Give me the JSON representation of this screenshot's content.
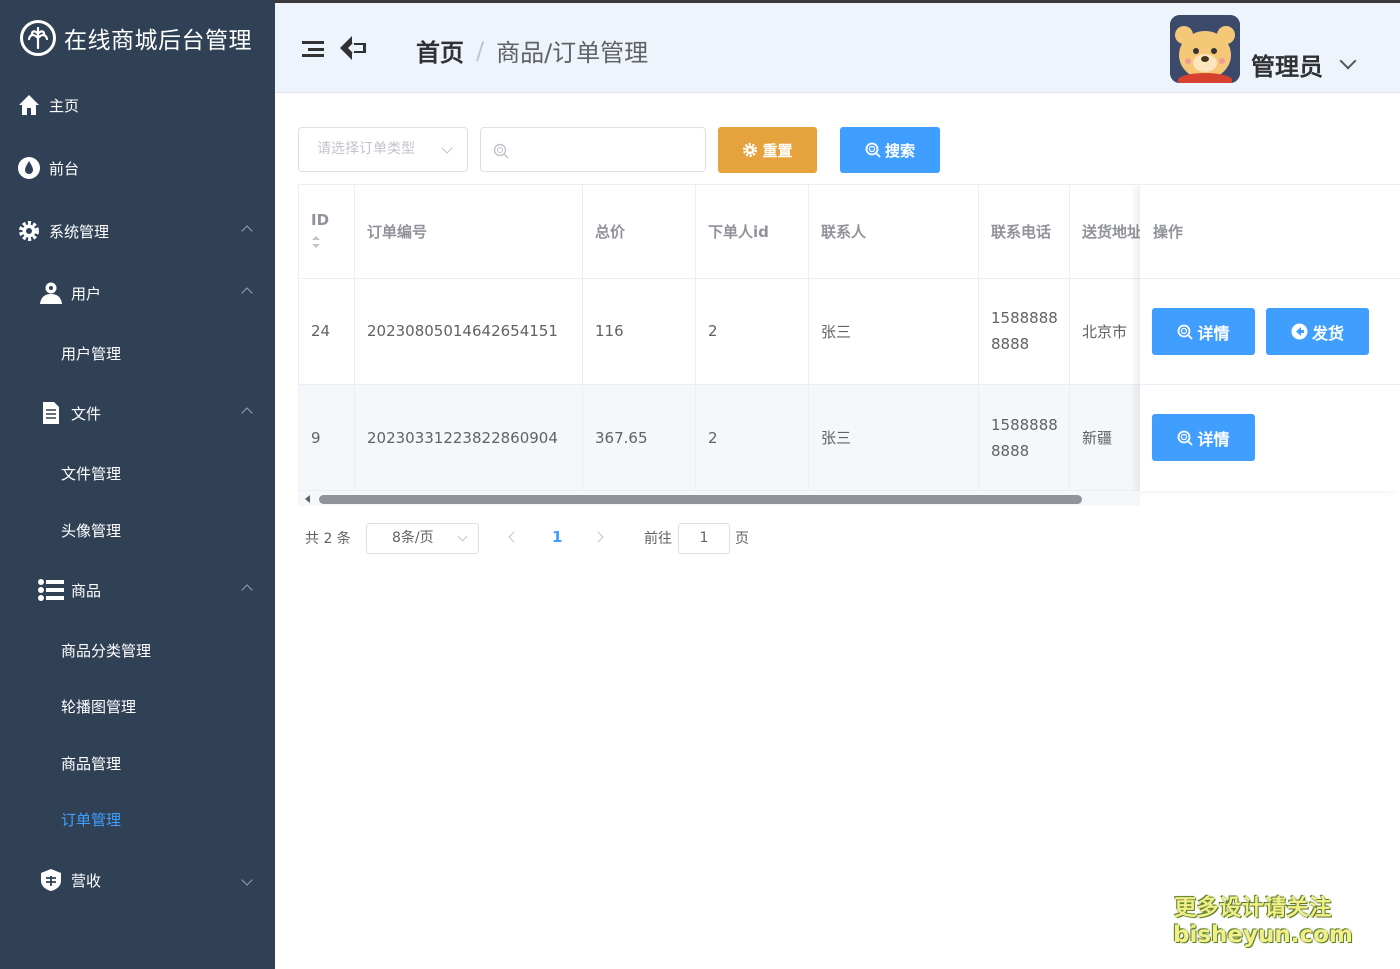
{
  "app": {
    "title": "在线商城后台管理"
  },
  "sidebar": {
    "items": [
      {
        "label": "主页"
      },
      {
        "label": "前台"
      },
      {
        "label": "系统管理"
      },
      {
        "label": "用户"
      },
      {
        "label": "用户管理"
      },
      {
        "label": "文件"
      },
      {
        "label": "文件管理"
      },
      {
        "label": "头像管理"
      },
      {
        "label": "商品"
      },
      {
        "label": "商品分类管理"
      },
      {
        "label": "轮播图管理"
      },
      {
        "label": "商品管理"
      },
      {
        "label": "订单管理"
      },
      {
        "label": "营收"
      }
    ],
    "active_color": "#409eff",
    "bg_color": "#304156"
  },
  "header": {
    "breadcrumb_home": "首页",
    "breadcrumb_sep": "/",
    "breadcrumb_current": "商品/订单管理",
    "user_name": "管理员"
  },
  "filters": {
    "type_placeholder": "请选择订单类型",
    "search_placeholder": "",
    "reset_label": "重置",
    "search_label": "搜索"
  },
  "table": {
    "columns": [
      "ID",
      "订单编号",
      "总价",
      "下单人id",
      "联系人",
      "联系电话",
      "送货地址",
      "操作"
    ],
    "rows": [
      {
        "id": "24",
        "order_no": "20230805014642654151",
        "total": "116",
        "user_id": "2",
        "contact": "张三",
        "phone_1": "1588888",
        "phone_2": "8888",
        "address": "北京市",
        "actions": [
          "详情",
          "发货"
        ]
      },
      {
        "id": "9",
        "order_no": "20230331223822860904",
        "total": "367.65",
        "user_id": "2",
        "contact": "张三",
        "phone_1": "1588888",
        "phone_2": "8888",
        "address": "新疆",
        "actions": [
          "详情"
        ]
      }
    ]
  },
  "pagination": {
    "total_text": "共 2 条",
    "page_size": "8条/页",
    "current_page": "1",
    "goto_label": "前往",
    "goto_value": "1",
    "goto_unit": "页"
  },
  "watermark": {
    "line1": "更多设计请关注",
    "line2": "bisheyun.com"
  },
  "colors": {
    "primary": "#409eff",
    "warning": "#e6a23c"
  }
}
